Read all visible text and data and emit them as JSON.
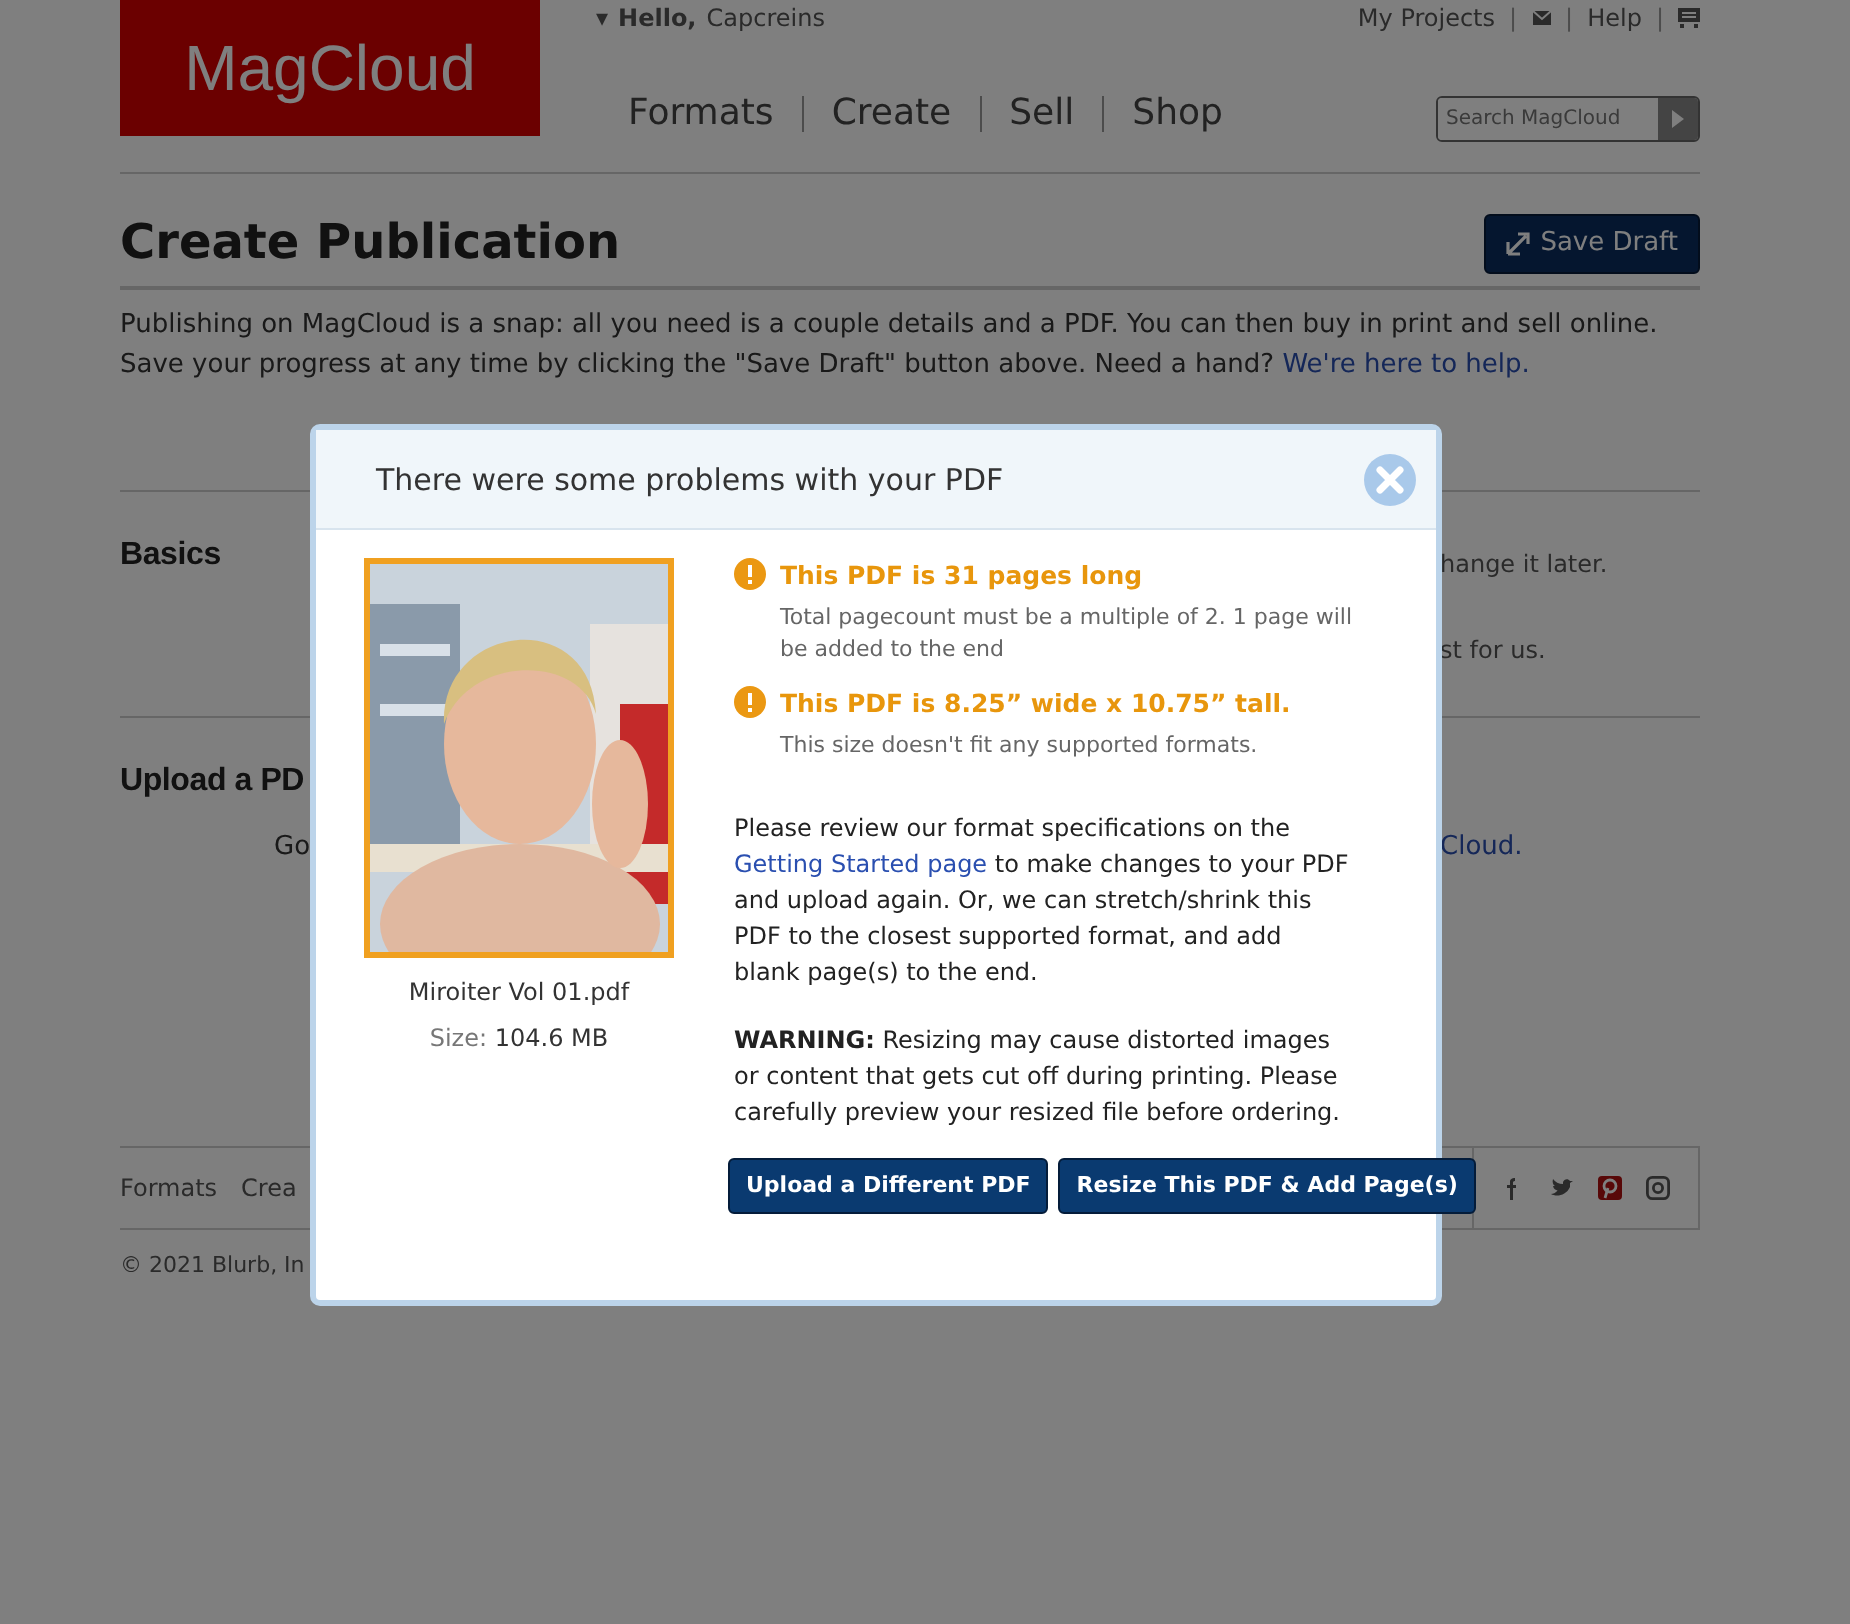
{
  "header": {
    "logo": "MagCloud",
    "greeting": {
      "caret": "▾",
      "hello": "Hello,",
      "user": "Capcreins"
    },
    "top_links": [
      {
        "kind": "text",
        "label": "My Projects"
      },
      {
        "kind": "separator",
        "label": "|"
      },
      {
        "kind": "mail"
      },
      {
        "kind": "separator",
        "label": "|"
      },
      {
        "kind": "text",
        "label": "Help"
      },
      {
        "kind": "separator",
        "label": "|"
      },
      {
        "kind": "cart"
      }
    ],
    "nav": [
      "Formats",
      "Create",
      "Sell",
      "Shop"
    ],
    "search": {
      "placeholder": "Search MagCloud"
    }
  },
  "page": {
    "title": "Create Publication",
    "save_draft": "Save Draft",
    "intro": {
      "text": "Publishing on MagCloud is a snap: all you need is a couple details and a PDF. You can then buy in print and sell online. Save your progress at any time by clicking the \"Save Draft\" button above. Need a hand? ",
      "link": "We're here to help."
    },
    "basics": {
      "heading": "Basics",
      "notes": [
        "hange it later.",
        "st for us."
      ]
    },
    "upload": {
      "heading": "Upload a PD",
      "text_start": "Go",
      "link_end": "Cloud."
    }
  },
  "footer": {
    "links": [
      "Formats",
      "Crea"
    ],
    "copyright": "© 2021 Blurb, In"
  },
  "modal": {
    "title": "There were some problems with your PDF",
    "file": {
      "name": "Miroiter Vol 01.pdf",
      "size_label": "Size:",
      "size": "104.6 MB"
    },
    "problems": [
      {
        "title": "This PDF is 31 pages long",
        "detail": "Total pagecount must be a multiple of 2. 1 page will be added to the end"
      },
      {
        "title": "This PDF is 8.25” wide x 10.75” tall.",
        "detail": "This size doesn't fit any supported formats."
      }
    ],
    "review": {
      "before": "Please review our format specifications on the ",
      "link": "Getting Started page",
      "after": " to make changes to your PDF and upload again. Or, we can stretch/shrink this PDF to the closest supported format, and add blank page(s) to the end."
    },
    "warning": {
      "label": "WARNING:",
      "text": " Resizing may cause distorted images or content that gets cut off during printing. Please carefully preview your resized file before ordering."
    },
    "buttons": [
      "Upload a Different PDF",
      "Resize This PDF & Add Page(s)"
    ]
  }
}
